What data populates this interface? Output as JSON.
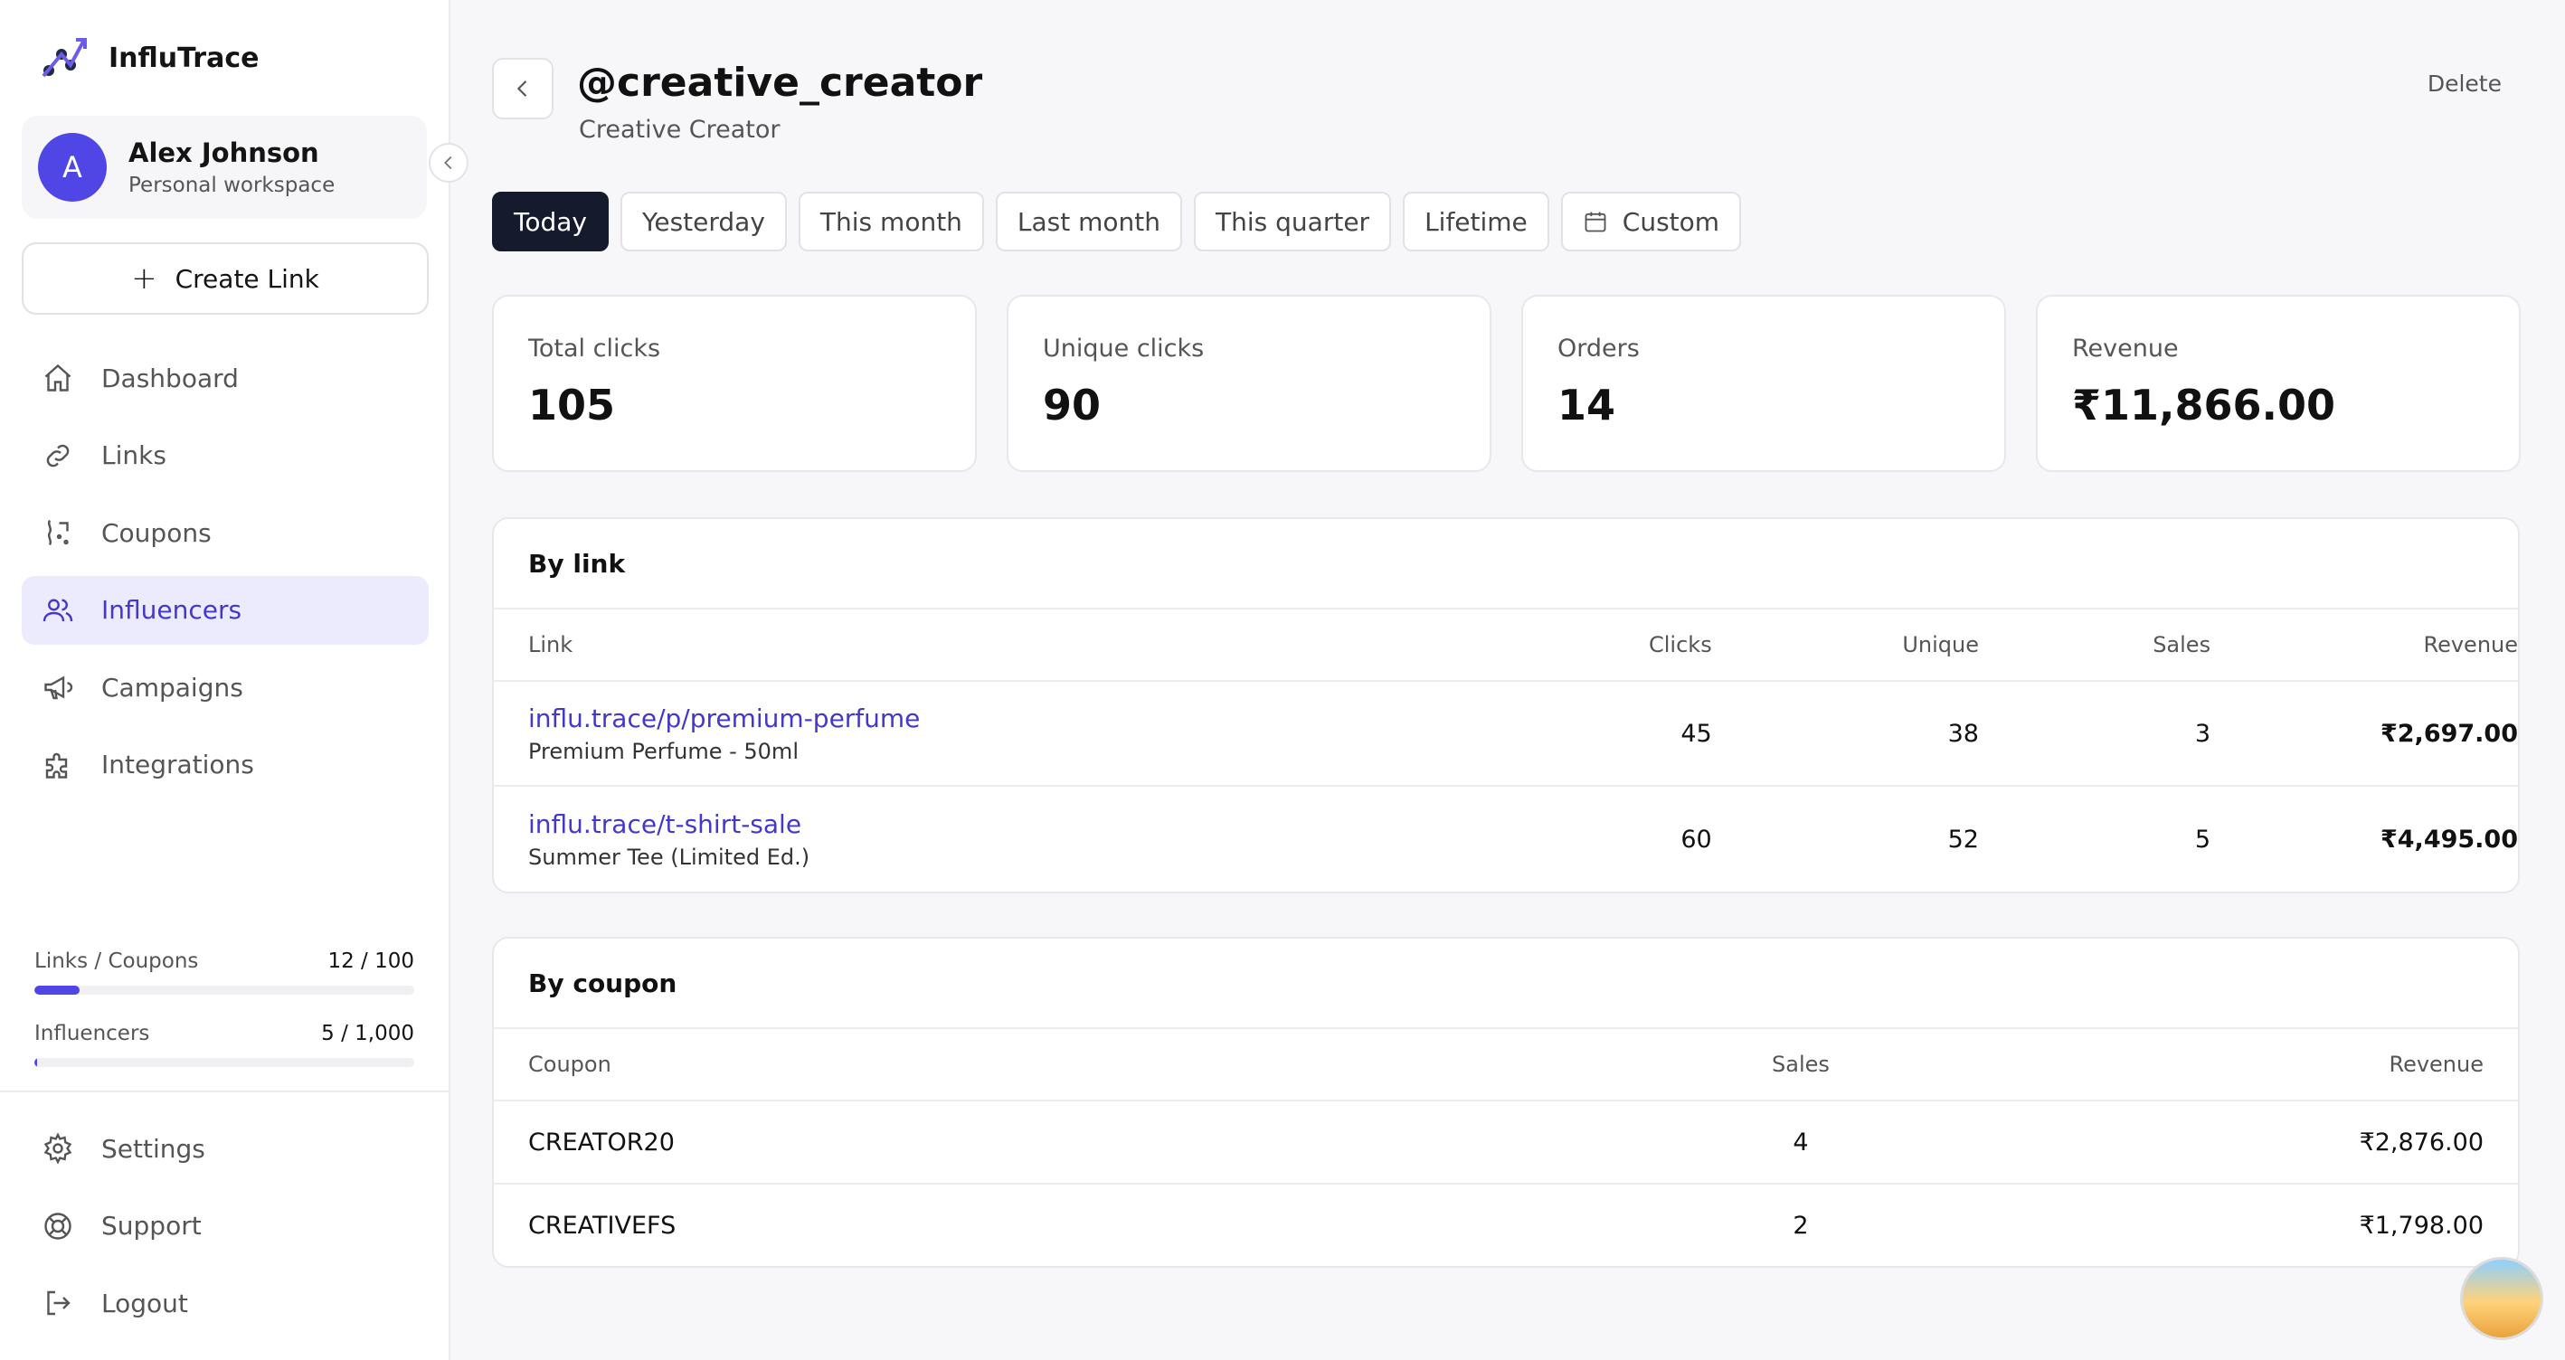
{
  "brand": {
    "name": "InfluTrace",
    "logo_icon": "chart-trend-icon"
  },
  "workspace": {
    "initial": "A",
    "name": "Alex Johnson",
    "subtitle": "Personal workspace"
  },
  "create_link": {
    "label": "Create Link",
    "icon": "plus-icon"
  },
  "nav": [
    {
      "label": "Dashboard",
      "icon": "home-icon"
    },
    {
      "label": "Links",
      "icon": "link-icon"
    },
    {
      "label": "Coupons",
      "icon": "coupon-icon"
    },
    {
      "label": "Influencers",
      "icon": "users-icon",
      "active": true
    },
    {
      "label": "Campaigns",
      "icon": "megaphone-icon"
    },
    {
      "label": "Integrations",
      "icon": "puzzle-icon"
    }
  ],
  "usage": [
    {
      "label": "Links / Coupons",
      "count": "12 / 100",
      "fraction": 0.12
    },
    {
      "label": "Influencers",
      "count": "5 / 1,000",
      "fraction": 0.005
    }
  ],
  "bottom_nav": [
    {
      "label": "Settings",
      "icon": "gear-icon"
    },
    {
      "label": "Support",
      "icon": "lifebuoy-icon"
    },
    {
      "label": "Logout",
      "icon": "logout-icon"
    }
  ],
  "header": {
    "handle": "@creative_creator",
    "display_name": "Creative Creator",
    "delete_label": "Delete"
  },
  "ranges": [
    "Today",
    "Yesterday",
    "This month",
    "Last month",
    "This quarter",
    "Lifetime"
  ],
  "custom_range": {
    "label": "Custom",
    "icon": "calendar-icon"
  },
  "stats": [
    {
      "label": "Total clicks",
      "value": "105"
    },
    {
      "label": "Unique clicks",
      "value": "90"
    },
    {
      "label": "Orders",
      "value": "14"
    },
    {
      "label": "Revenue",
      "value": "₹11,866.00"
    }
  ],
  "by_link": {
    "title": "By link",
    "columns": [
      "Link",
      "Clicks",
      "Unique",
      "Sales",
      "Revenue"
    ],
    "rows": [
      {
        "url": "influ.trace/p/premium-perfume",
        "name": "Premium Perfume - 50ml",
        "clicks": "45",
        "unique": "38",
        "sales": "3",
        "revenue": "₹2,697.00"
      },
      {
        "url": "influ.trace/t-shirt-sale",
        "name": "Summer Tee (Limited Ed.)",
        "clicks": "60",
        "unique": "52",
        "sales": "5",
        "revenue": "₹4,495.00"
      }
    ]
  },
  "by_coupon": {
    "title": "By coupon",
    "columns": [
      "Coupon",
      "Sales",
      "Revenue"
    ],
    "rows": [
      {
        "code": "CREATOR20",
        "sales": "4",
        "revenue": "₹2,876.00"
      },
      {
        "code": "CREATIVEFS",
        "sales": "2",
        "revenue": "₹1,798.00"
      }
    ]
  }
}
